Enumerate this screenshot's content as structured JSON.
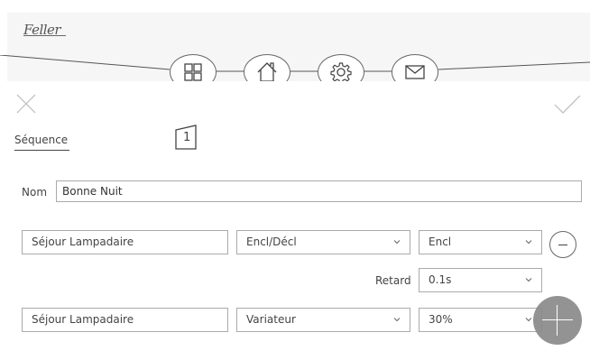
{
  "header": {
    "logo_text": "Feller"
  },
  "nav": {
    "items": [
      {
        "name": "grid",
        "icon": "grid-icon"
      },
      {
        "name": "home",
        "icon": "home-icon"
      },
      {
        "name": "settings",
        "icon": "gear-icon"
      },
      {
        "name": "mail",
        "icon": "mail-icon"
      }
    ]
  },
  "toolbar": {
    "cancel_icon": "close-icon",
    "confirm_icon": "check-icon"
  },
  "tabs": {
    "sequence_label": "Séquence",
    "sequence_number": "1"
  },
  "form": {
    "name_label": "Nom",
    "name_value": "Bonne Nuit"
  },
  "rows": [
    {
      "device": "Séjour Lampadaire",
      "function": "Encl/Décl",
      "value": "Encl"
    },
    {
      "device": "Séjour Lampadaire",
      "function": "Variateur",
      "value": "30%"
    }
  ],
  "delay": {
    "label": "Retard",
    "value": "0.1s"
  },
  "colors": {
    "accent": "#8a8a8a",
    "border": "#aaaaaa"
  }
}
